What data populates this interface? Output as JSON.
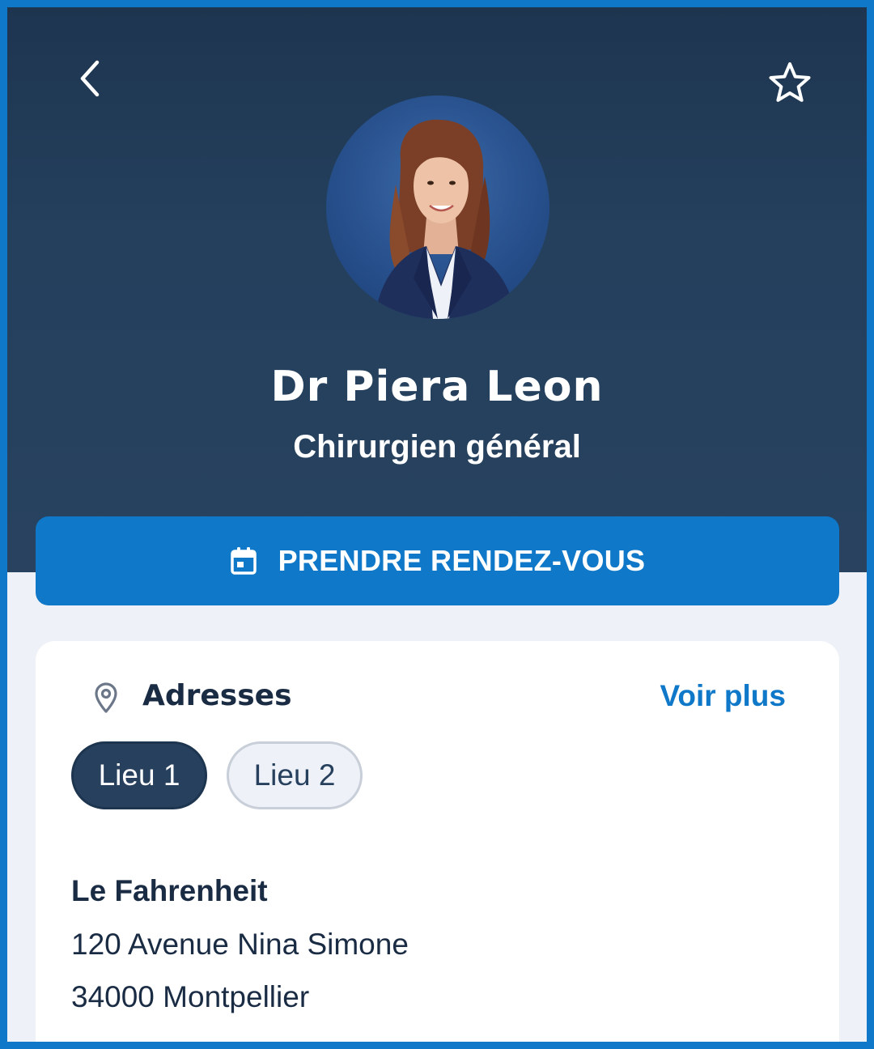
{
  "header": {
    "back_icon": "chevron-left-icon",
    "favorite_icon": "star-outline-icon"
  },
  "doctor": {
    "name": "Dr Piera Leon",
    "specialty": "Chirurgien général",
    "photo": "doctor-portrait"
  },
  "cta": {
    "icon": "calendar-icon",
    "label": "PRENDRE RENDEZ-VOUS"
  },
  "addresses": {
    "icon": "location-pin-icon",
    "title": "Adresses",
    "see_more": "Voir plus",
    "tabs": [
      {
        "label": "Lieu 1",
        "selected": true
      },
      {
        "label": "Lieu 2",
        "selected": false
      }
    ],
    "selected_location": {
      "name": "Le Fahrenheit",
      "street": "120 Avenue Nina Simone",
      "city": "34000 Montpellier"
    }
  },
  "colors": {
    "header_bg": "#24405d",
    "accent": "#0f78c8",
    "page_bg": "#eef2f8",
    "text_dark": "#1a2b44",
    "chip_active": "#26405e"
  }
}
